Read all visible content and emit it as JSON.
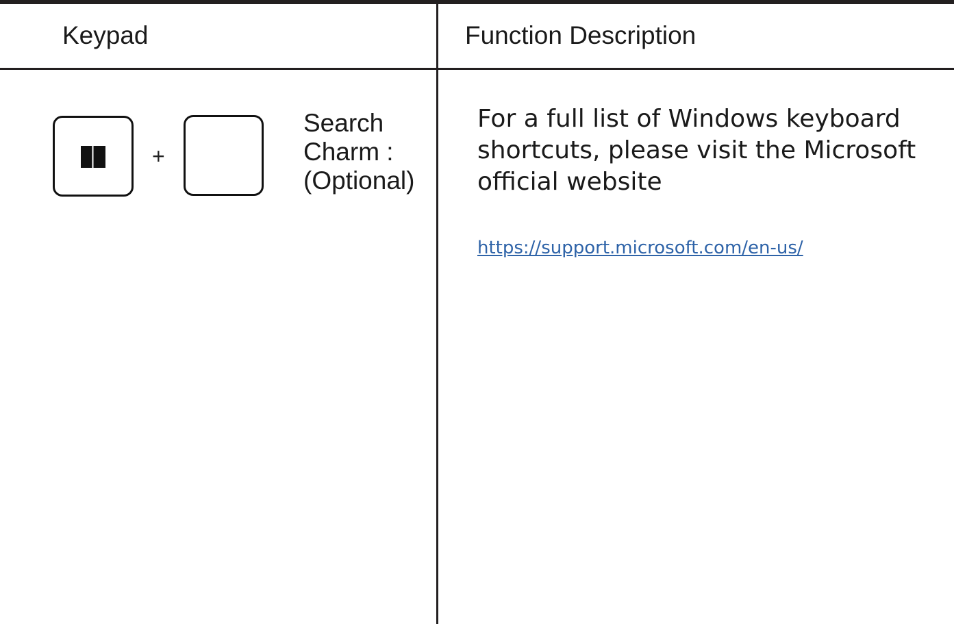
{
  "table": {
    "headers": {
      "keypad": "Keypad",
      "function": "Function Description"
    },
    "row": {
      "keys": [
        {
          "icon": "windows-logo-icon",
          "label": ""
        },
        {
          "icon": "",
          "label": ""
        }
      ],
      "joiner": "+",
      "action_lines": [
        "Search",
        "Charm :",
        "(Optional)"
      ],
      "description_lines": [
        "For a full list of Windows keyboard",
        "shortcuts, please visit the Microsoft",
        "official website"
      ],
      "link": "https://support.microsoft.com/en-us/"
    }
  },
  "colors": {
    "rule": "#231f20",
    "link": "#2e63a8",
    "text": "#1a1a1a"
  }
}
